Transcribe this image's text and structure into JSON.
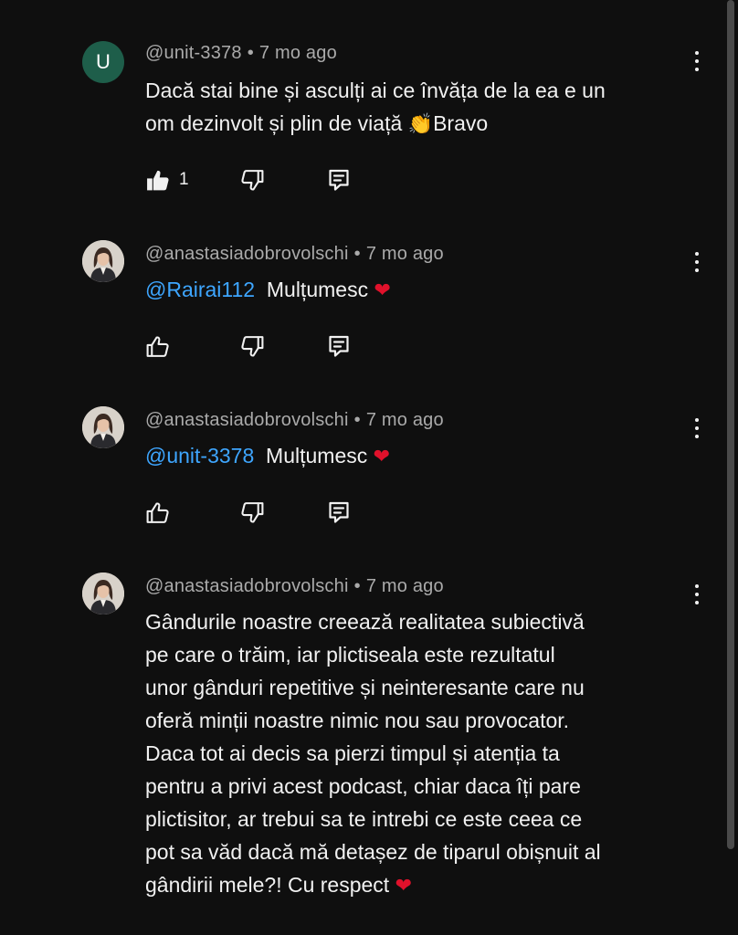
{
  "comments": [
    {
      "avatar_letter": "U",
      "author": "@unit-3378",
      "time": "7 mo ago",
      "text_line1": "Dacă stai bine și asculți ai ce învăța de la ea e un",
      "text_line2_a": "om dezinvolt și plin de viață ",
      "text_line2_emoji": "👏",
      "text_line2_b": "Bravo",
      "like_count": "1",
      "liked": true
    },
    {
      "author": "@anastasiadobrovolschi",
      "time": "7 mo ago",
      "mention": "@Rairai112",
      "text": "Mulțumesc",
      "emoji": "❤"
    },
    {
      "author": "@anastasiadobrovolschi",
      "time": "7 mo ago",
      "mention": "@unit-3378",
      "text": "Mulțumesc",
      "emoji": "❤"
    },
    {
      "author": "@anastasiadobrovolschi",
      "time": "7 mo ago",
      "lines": [
        "Gândurile noastre creează realitatea subiectivă",
        "pe care o trăim, iar plictiseala este rezultatul",
        "unor gânduri repetitive și neinteresante care nu",
        "oferă minții noastre nimic nou sau provocator.",
        "Daca tot ai decis sa pierzi timpul și atenția ta",
        "pentru a privi acest podcast, chiar daca îți pare",
        "plictisitor,  ar trebui sa te intrebi ce este ceea ce",
        "pot sa văd dacă mă detașez de tiparul obișnuit al",
        "gândirii mele?!  Cu respect "
      ],
      "emoji": "❤"
    }
  ],
  "meta_separator": "•",
  "icons": {
    "like": "thumbs-up-icon",
    "dislike": "thumbs-down-icon",
    "reply": "reply-comment-icon",
    "more": "more-vertical-icon"
  },
  "colors": {
    "background": "#0f0f0f",
    "text": "#f1f1f1",
    "meta": "#aaaaaa",
    "mention": "#3ea6ff",
    "heart": "#e0112b",
    "avatar_u": "#1e5e4a"
  }
}
